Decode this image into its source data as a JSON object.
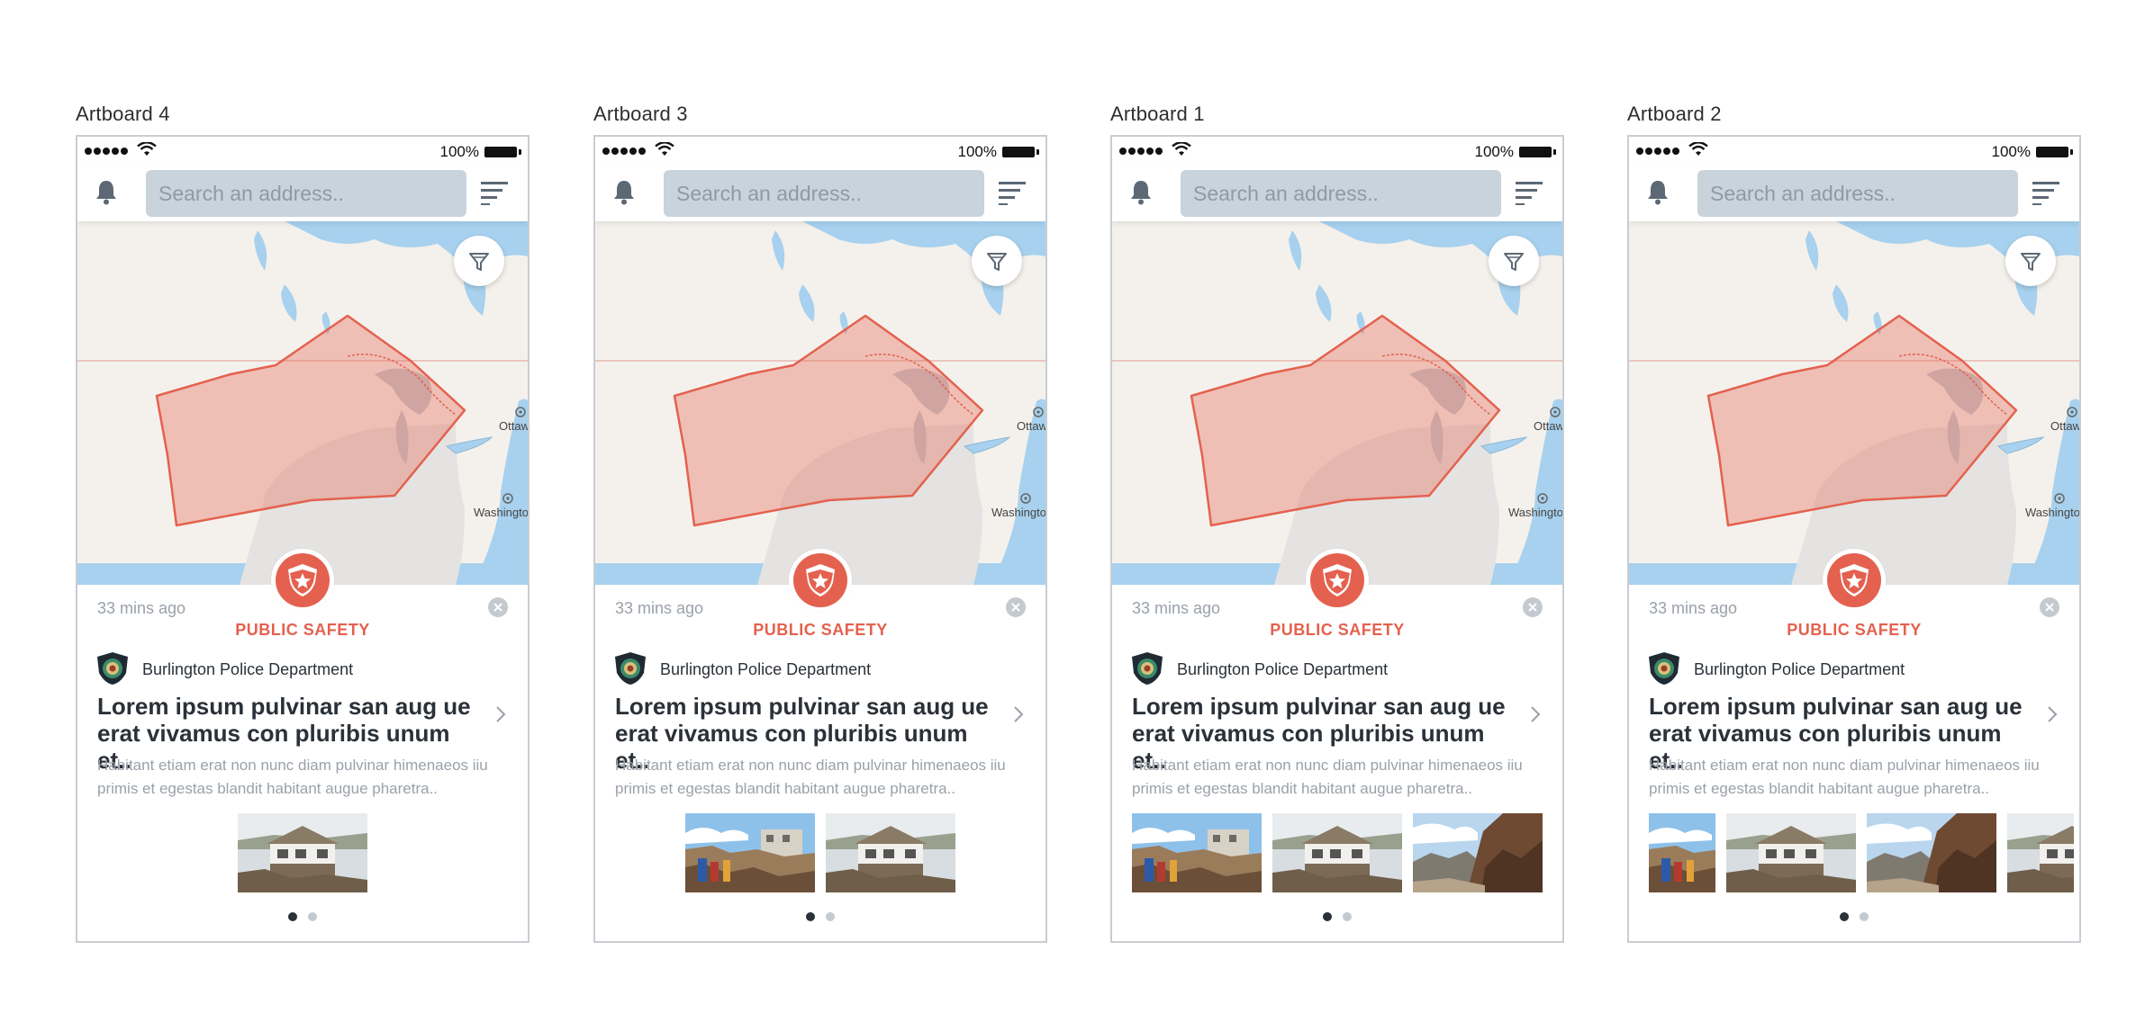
{
  "artboards": [
    {
      "label": "Artboard 4",
      "thumbs": [
        "house"
      ]
    },
    {
      "label": "Artboard 3",
      "thumbs": [
        "rubble",
        "house"
      ]
    },
    {
      "label": "Artboard 1",
      "thumbs": [
        "rubble",
        "house",
        "cliff"
      ]
    },
    {
      "label": "Artboard 2",
      "thumbs": [
        "rubble",
        "house",
        "cliff",
        "house"
      ]
    }
  ],
  "status": {
    "battery": "100%"
  },
  "search": {
    "placeholder": "Search an address.."
  },
  "map": {
    "city_1": "Ottawa",
    "city_2": "Washington"
  },
  "card": {
    "time": "33 mins ago",
    "category": "PUBLIC SAFETY",
    "department": "Burlington Police Department",
    "title": "Lorem ipsum pulvinar san aug ue erat vivamus con pluribis unum et..",
    "body": "Habitant etiam erat non nunc diam pulvinar himenaeos iiu primis et egestas blandit habitant augue pharetra..",
    "pages_total": 2,
    "page_active": 1
  },
  "colors": {
    "accent": "#e4614f",
    "search_bg": "#c9d3dc",
    "water": "#a7d1ee",
    "land": "#f4f1ec"
  },
  "icons": [
    "bell-icon",
    "menu-icon",
    "filter-icon",
    "shield-star-icon",
    "close-icon",
    "chevron-right-icon",
    "wifi-icon",
    "battery-icon"
  ]
}
